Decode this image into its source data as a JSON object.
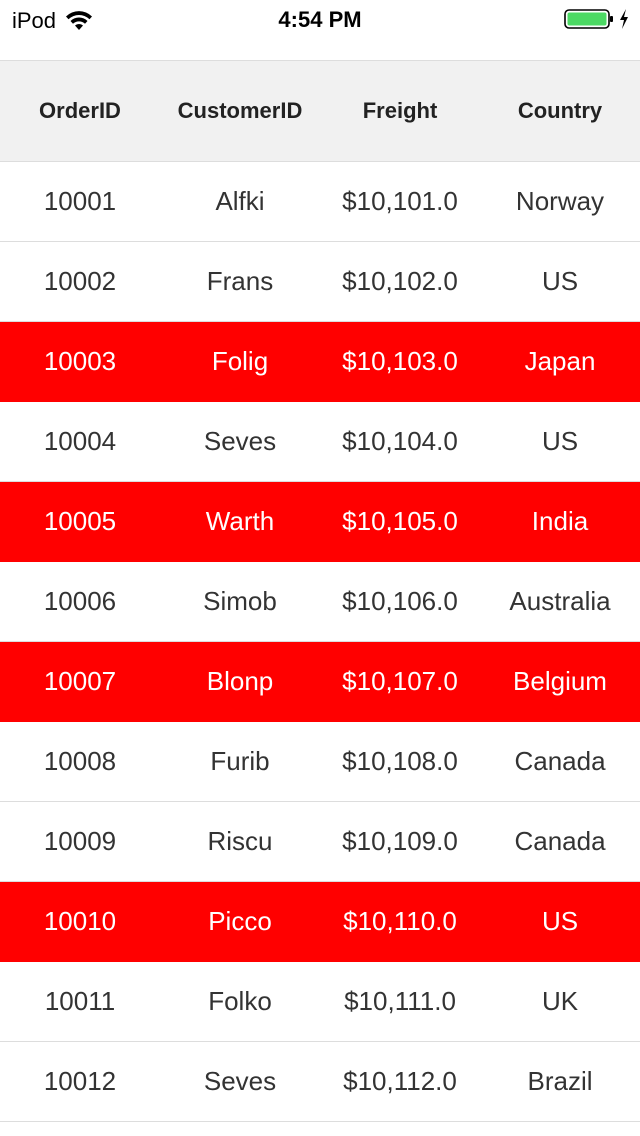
{
  "status_bar": {
    "carrier": "iPod",
    "time": "4:54 PM",
    "battery_color": "#4cd964"
  },
  "grid": {
    "highlight_color": "#ff0000",
    "columns": [
      "OrderID",
      "CustomerID",
      "Freight",
      "Country"
    ],
    "rows": [
      {
        "order_id": "10001",
        "customer_id": "Alfki",
        "freight": "$10,101.0",
        "country": "Norway",
        "highlighted": false
      },
      {
        "order_id": "10002",
        "customer_id": "Frans",
        "freight": "$10,102.0",
        "country": "US",
        "highlighted": false
      },
      {
        "order_id": "10003",
        "customer_id": "Folig",
        "freight": "$10,103.0",
        "country": "Japan",
        "highlighted": true
      },
      {
        "order_id": "10004",
        "customer_id": "Seves",
        "freight": "$10,104.0",
        "country": "US",
        "highlighted": false
      },
      {
        "order_id": "10005",
        "customer_id": "Warth",
        "freight": "$10,105.0",
        "country": "India",
        "highlighted": true
      },
      {
        "order_id": "10006",
        "customer_id": "Simob",
        "freight": "$10,106.0",
        "country": "Australia",
        "highlighted": false
      },
      {
        "order_id": "10007",
        "customer_id": "Blonp",
        "freight": "$10,107.0",
        "country": "Belgium",
        "highlighted": true
      },
      {
        "order_id": "10008",
        "customer_id": "Furib",
        "freight": "$10,108.0",
        "country": "Canada",
        "highlighted": false
      },
      {
        "order_id": "10009",
        "customer_id": "Riscu",
        "freight": "$10,109.0",
        "country": "Canada",
        "highlighted": false
      },
      {
        "order_id": "10010",
        "customer_id": "Picco",
        "freight": "$10,110.0",
        "country": "US",
        "highlighted": true
      },
      {
        "order_id": "10011",
        "customer_id": "Folko",
        "freight": "$10,111.0",
        "country": "UK",
        "highlighted": false
      },
      {
        "order_id": "10012",
        "customer_id": "Seves",
        "freight": "$10,112.0",
        "country": "Brazil",
        "highlighted": false
      }
    ]
  }
}
